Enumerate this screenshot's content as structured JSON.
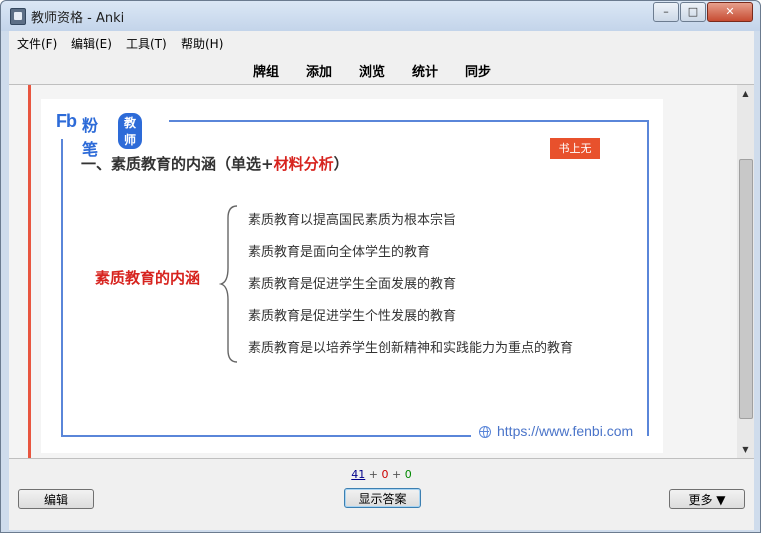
{
  "window": {
    "title": "教师资格 - Anki",
    "controls": {
      "minimize": "–",
      "maximize": "□",
      "close": "✕"
    }
  },
  "menu": [
    "文件(F)",
    "编辑(E)",
    "工具(T)",
    "帮助(H)"
  ],
  "toolbar": [
    "牌组",
    "添加",
    "浏览",
    "统计",
    "同步"
  ],
  "card": {
    "logo": {
      "mark": "Fb",
      "brand": "粉笔",
      "badge": "教师"
    },
    "heading_black": "一、素质教育的内涵（单选+",
    "heading_red": "材料分析",
    "heading_end": "）",
    "tag": "书上无",
    "concept": "素质教育的内涵",
    "items": [
      "素质教育以提高国民素质为根本宗旨",
      "素质教育是面向全体学生的教育",
      "素质教育是促进学生全面发展的教育",
      "素质教育是促进学生个性发展的教育",
      "素质教育是以培养学生创新精神和实践能力为重点的教育"
    ],
    "url": "https://www.fenbi.com"
  },
  "counts": {
    "new": "41",
    "sep": "+",
    "learn": "0",
    "review": "0"
  },
  "buttons": {
    "edit": "编辑",
    "show_answer": "显示答案",
    "more": "更多 ▼"
  },
  "colors": {
    "accent_red": "#d7231e",
    "brand_blue": "#2d6bd8",
    "left_bar": "#e8553f"
  }
}
